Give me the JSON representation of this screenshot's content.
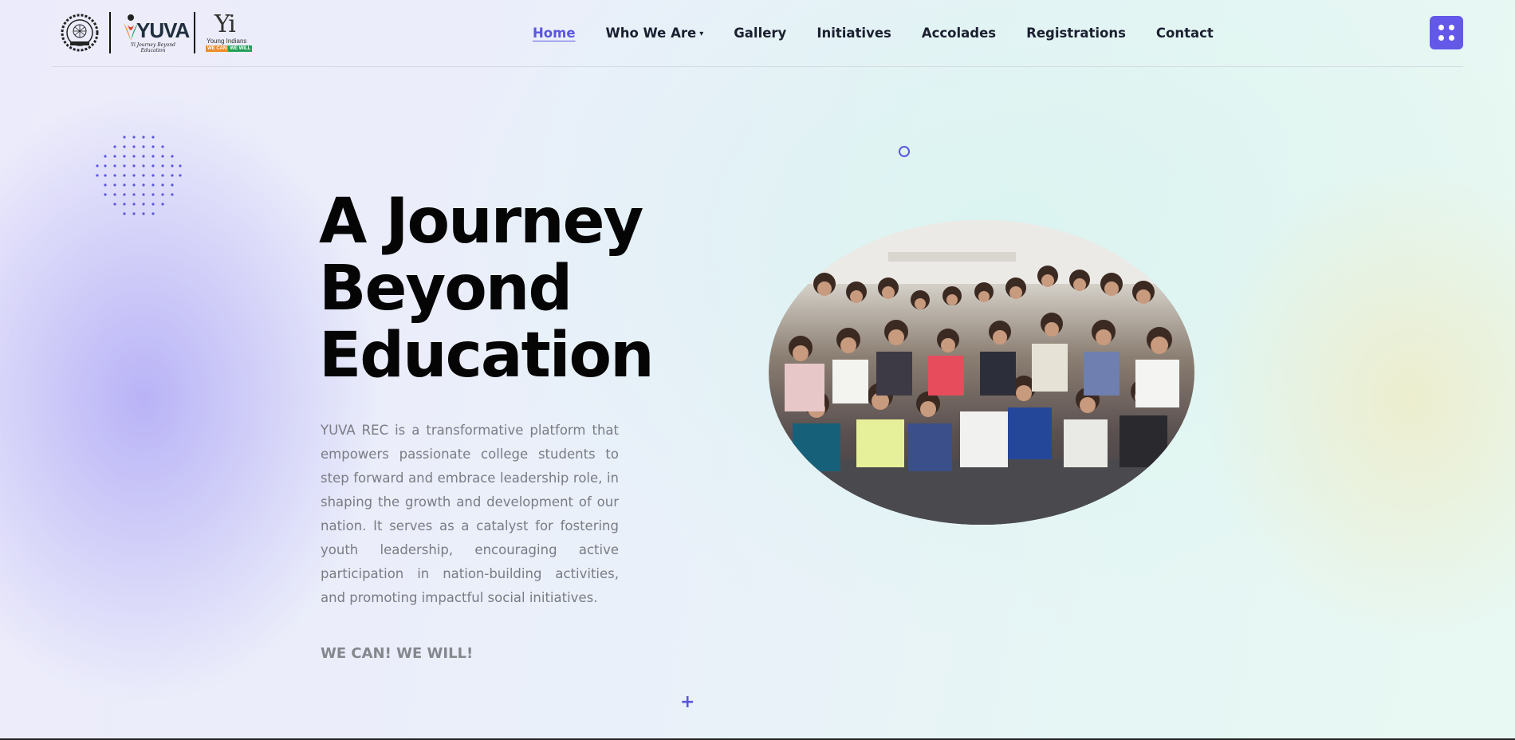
{
  "header": {
    "logos": {
      "seal": "institution-seal-logo",
      "yuva_word": "YUVA",
      "yuva_tagline": "Yi Journey Beyond Education",
      "yi_mark": "Yi",
      "yi_name": "Young Indians",
      "yi_motto_left": "WE CAN",
      "yi_motto_right": "WE WILL"
    },
    "nav": [
      {
        "label": "Home",
        "active": true
      },
      {
        "label": "Who We Are",
        "dropdown": true
      },
      {
        "label": "Gallery"
      },
      {
        "label": "Initiatives"
      },
      {
        "label": "Accolades"
      },
      {
        "label": "Registrations"
      },
      {
        "label": "Contact"
      }
    ],
    "dropdown_icon": "chevron-down-icon",
    "menu_button_icon": "grid-dots-icon"
  },
  "hero": {
    "title_line1": "A Journey",
    "title_line2": "Beyond",
    "title_line3": "Education",
    "description": "YUVA REC is a transformative platform that empowers passionate college students to step forward and embrace leadership role, in shaping the growth and development of our nation. It serves as a catalyst for fostering youth leadership, encouraging active participation in nation-building activities, and promoting impactful social initiatives.",
    "slogan": "WE CAN! WE WILL!",
    "photo": "group-photo-students"
  },
  "colors": {
    "accent": "#5b56e0",
    "menu_button": "#6358e8",
    "title": "#050505",
    "body_text": "#7a7c82",
    "motto_orange": "#f08a24",
    "motto_green": "#22a05a"
  }
}
